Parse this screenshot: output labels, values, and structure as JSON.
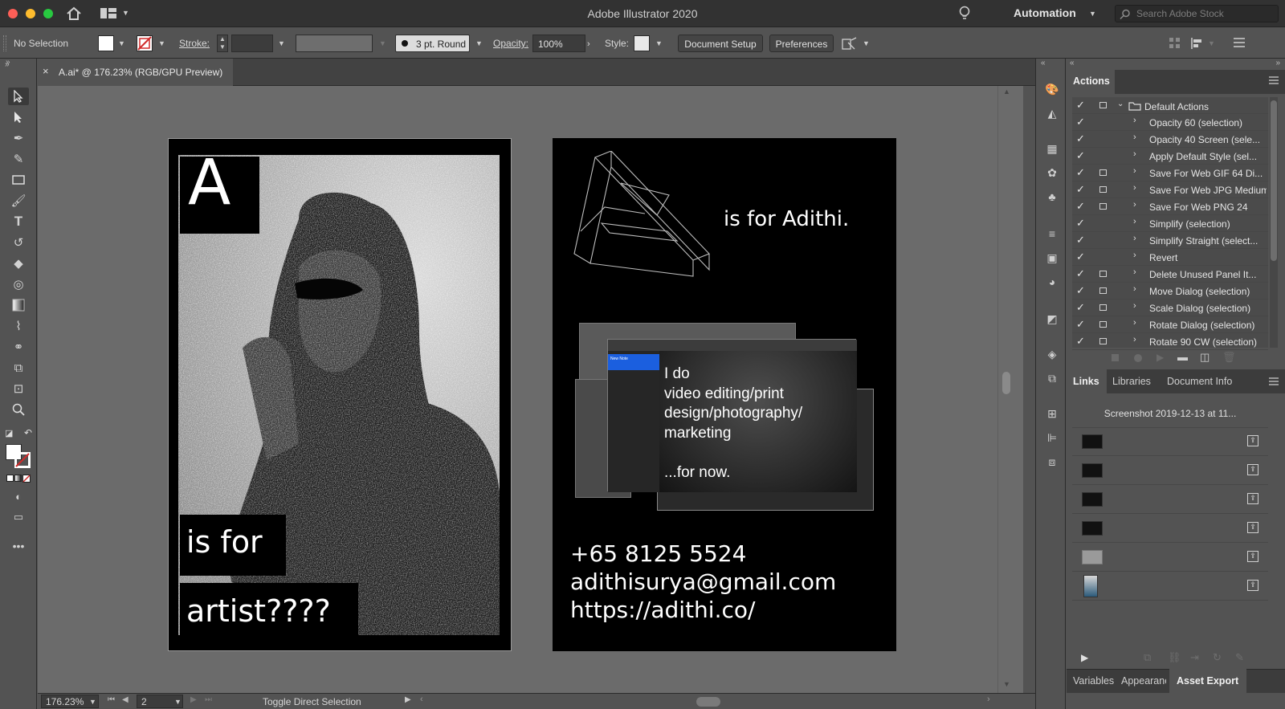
{
  "app": {
    "title": "Adobe Illustrator 2020",
    "workspace": "Automation",
    "search_placeholder": "Search Adobe Stock"
  },
  "control_bar": {
    "selection": "No Selection",
    "stroke_label": "Stroke:",
    "brush": "3 pt. Round",
    "opacity_label": "Opacity:",
    "opacity_value": "100%",
    "style_label": "Style:",
    "document_setup": "Document Setup",
    "preferences": "Preferences"
  },
  "document_tab": {
    "title": "A.ai* @ 176.23% (RGB/GPU Preview)",
    "close_glyph": "×"
  },
  "artboard_left": {
    "big_letter": "A",
    "line1": "is for",
    "line2": "artist????"
  },
  "artboard_right": {
    "headline": "is for Adithi.",
    "screen_text": [
      "I do",
      "video editing/print",
      "design/photography/",
      "marketing",
      "",
      "...for now."
    ],
    "note_title": "New Note",
    "phone": "+65 8125 5524",
    "email": "adithisurya@gmail.com",
    "url": "https://adithi.co/"
  },
  "status_bar": {
    "zoom": "176.23%",
    "page": "2",
    "hint": "Toggle Direct Selection"
  },
  "actions_panel": {
    "tab": "Actions",
    "set_name": "Default Actions",
    "items": [
      {
        "name": "Opacity 60 (selection)",
        "dialog": false
      },
      {
        "name": "Opacity 40 Screen (sele...",
        "dialog": false
      },
      {
        "name": "Apply Default Style (sel...",
        "dialog": false
      },
      {
        "name": "Save For Web GIF 64 Di...",
        "dialog": true
      },
      {
        "name": "Save For Web JPG Medium",
        "dialog": true
      },
      {
        "name": "Save For Web PNG 24",
        "dialog": true
      },
      {
        "name": "Simplify (selection)",
        "dialog": false
      },
      {
        "name": "Simplify Straight (select...",
        "dialog": false
      },
      {
        "name": "Revert",
        "dialog": false
      },
      {
        "name": "Delete Unused Panel It...",
        "dialog": true
      },
      {
        "name": "Move Dialog (selection)",
        "dialog": true
      },
      {
        "name": "Scale Dialog (selection)",
        "dialog": true
      },
      {
        "name": "Rotate Dialog (selection)",
        "dialog": true
      },
      {
        "name": "Rotate 90 CW (selection)",
        "dialog": true
      }
    ]
  },
  "links_panel": {
    "tabs": [
      "Links",
      "Libraries",
      "Document Info"
    ],
    "header": "Screenshot 2019-12-13 at 11..."
  },
  "bottom_tabs": [
    "Variables",
    "Appearance",
    "Asset Export"
  ],
  "colors": {
    "chrome": "#535353",
    "canvas": "#6b6b6b",
    "artboard": "#000000"
  }
}
